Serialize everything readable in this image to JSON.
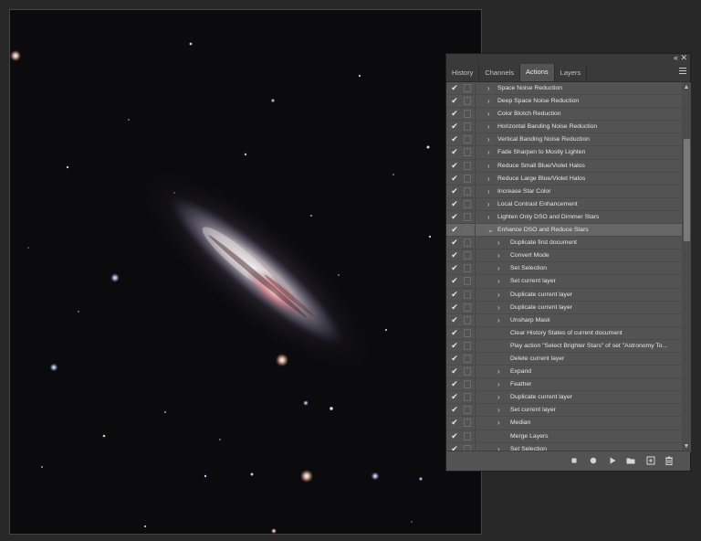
{
  "panel": {
    "tabs": [
      {
        "label": "History"
      },
      {
        "label": "Channels"
      },
      {
        "label": "Actions"
      },
      {
        "label": "Layers"
      }
    ],
    "active_tab": "Actions",
    "collapse_glyph": "«",
    "close_glyph": "✕",
    "actions": [
      {
        "label": "Space Noise Reduction",
        "indent": 0,
        "expander": "collapsed"
      },
      {
        "label": "Deep Space Noise Reduction",
        "indent": 0,
        "expander": "collapsed"
      },
      {
        "label": "Color Blotch Reduction",
        "indent": 0,
        "expander": "collapsed"
      },
      {
        "label": "Horizontal Banding Noise Reduction",
        "indent": 0,
        "expander": "collapsed"
      },
      {
        "label": "Vertical Banding Noise Reduction",
        "indent": 0,
        "expander": "collapsed"
      },
      {
        "label": "Fade Sharpen to Mostly Lighten",
        "indent": 0,
        "expander": "collapsed"
      },
      {
        "label": "Reduce Small Blue/Violet Halos",
        "indent": 0,
        "expander": "collapsed"
      },
      {
        "label": "Reduce Large Blue/Violet Halos",
        "indent": 0,
        "expander": "collapsed"
      },
      {
        "label": "Increase Star Color",
        "indent": 0,
        "expander": "collapsed"
      },
      {
        "label": "Local Contrast Enhancement",
        "indent": 0,
        "expander": "collapsed"
      },
      {
        "label": "Lighten Only DSO and Dimmer Stars",
        "indent": 0,
        "expander": "collapsed"
      },
      {
        "label": "Enhance DSO and Reduce Stars",
        "indent": 0,
        "expander": "expanded",
        "highlight": true
      },
      {
        "label": "Duplicate first document",
        "indent": 1,
        "expander": "collapsed"
      },
      {
        "label": "Convert Mode",
        "indent": 1,
        "expander": "collapsed"
      },
      {
        "label": "Set Selection",
        "indent": 1,
        "expander": "collapsed"
      },
      {
        "label": "Set current layer",
        "indent": 1,
        "expander": "collapsed"
      },
      {
        "label": "Duplicate current layer",
        "indent": 1,
        "expander": "collapsed"
      },
      {
        "label": "Duplicate current layer",
        "indent": 1,
        "expander": "collapsed"
      },
      {
        "label": "Unsharp Mask",
        "indent": 1,
        "expander": "collapsed"
      },
      {
        "label": "Clear History States of current document",
        "indent": 1,
        "expander": "none"
      },
      {
        "label": "Play action \"Select Brighter Stars\" of set \"Astronomy To...",
        "indent": 1,
        "expander": "none"
      },
      {
        "label": "Delete current layer",
        "indent": 1,
        "expander": "none"
      },
      {
        "label": "Expand",
        "indent": 1,
        "expander": "collapsed"
      },
      {
        "label": "Feather",
        "indent": 1,
        "expander": "collapsed"
      },
      {
        "label": "Duplicate current layer",
        "indent": 1,
        "expander": "collapsed"
      },
      {
        "label": "Set current layer",
        "indent": 1,
        "expander": "collapsed"
      },
      {
        "label": "Median",
        "indent": 1,
        "expander": "collapsed"
      },
      {
        "label": "Merge Layers",
        "indent": 1,
        "expander": "none"
      },
      {
        "label": "Set Selection",
        "indent": 1,
        "expander": "collapsed"
      }
    ],
    "toolbar_icons": [
      "stop-icon",
      "record-icon",
      "play-icon",
      "new-set-folder-icon",
      "new-action-icon",
      "trash-icon"
    ]
  },
  "colors": {
    "panel_bg": "#535353",
    "tab_bar_bg": "#3a3a3a",
    "highlight_row": "#666666",
    "canvas_bg": "#0b0a0d",
    "app_bg": "#282828"
  }
}
